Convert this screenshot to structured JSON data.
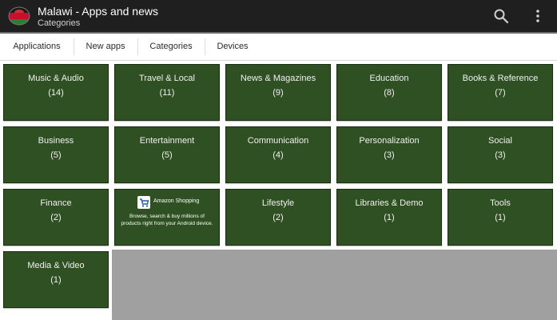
{
  "app_bar": {
    "title": "Malawi - Apps and news",
    "subtitle": "Categories",
    "icon": "malawi-flag-circle-icon",
    "actions": [
      "search-icon",
      "more-vert-icon"
    ]
  },
  "tabs": [
    {
      "label": "Applications"
    },
    {
      "label": "New apps"
    },
    {
      "label": "Categories"
    },
    {
      "label": "Devices"
    }
  ],
  "categories": [
    {
      "name": "Music & Audio",
      "count": "(14)"
    },
    {
      "name": "Travel & Local",
      "count": "(11)"
    },
    {
      "name": "News & Magazines",
      "count": "(9)"
    },
    {
      "name": "Education",
      "count": "(8)"
    },
    {
      "name": "Books & Reference",
      "count": "(7)"
    },
    {
      "name": "Business",
      "count": "(5)"
    },
    {
      "name": "Entertainment",
      "count": "(5)"
    },
    {
      "name": "Communication",
      "count": "(4)"
    },
    {
      "name": "Personalization",
      "count": "(3)"
    },
    {
      "name": "Social",
      "count": "(3)"
    },
    {
      "name": "Finance",
      "count": "(2)"
    },
    {
      "name": "Lifestyle",
      "count": "(2)"
    },
    {
      "name": "Libraries & Demo",
      "count": "(1)"
    },
    {
      "name": "Tools",
      "count": "(1)"
    },
    {
      "name": "Media & Video",
      "count": "(1)"
    }
  ],
  "ad": {
    "title": "Amazon Shopping",
    "description": "Browse, search & buy millions of products right from your Android device.",
    "icon": "shopping-cart-icon"
  },
  "colors": {
    "app_bar": "#1f1f1f",
    "tile": "#2f5022",
    "background": "#a0a0a0"
  }
}
